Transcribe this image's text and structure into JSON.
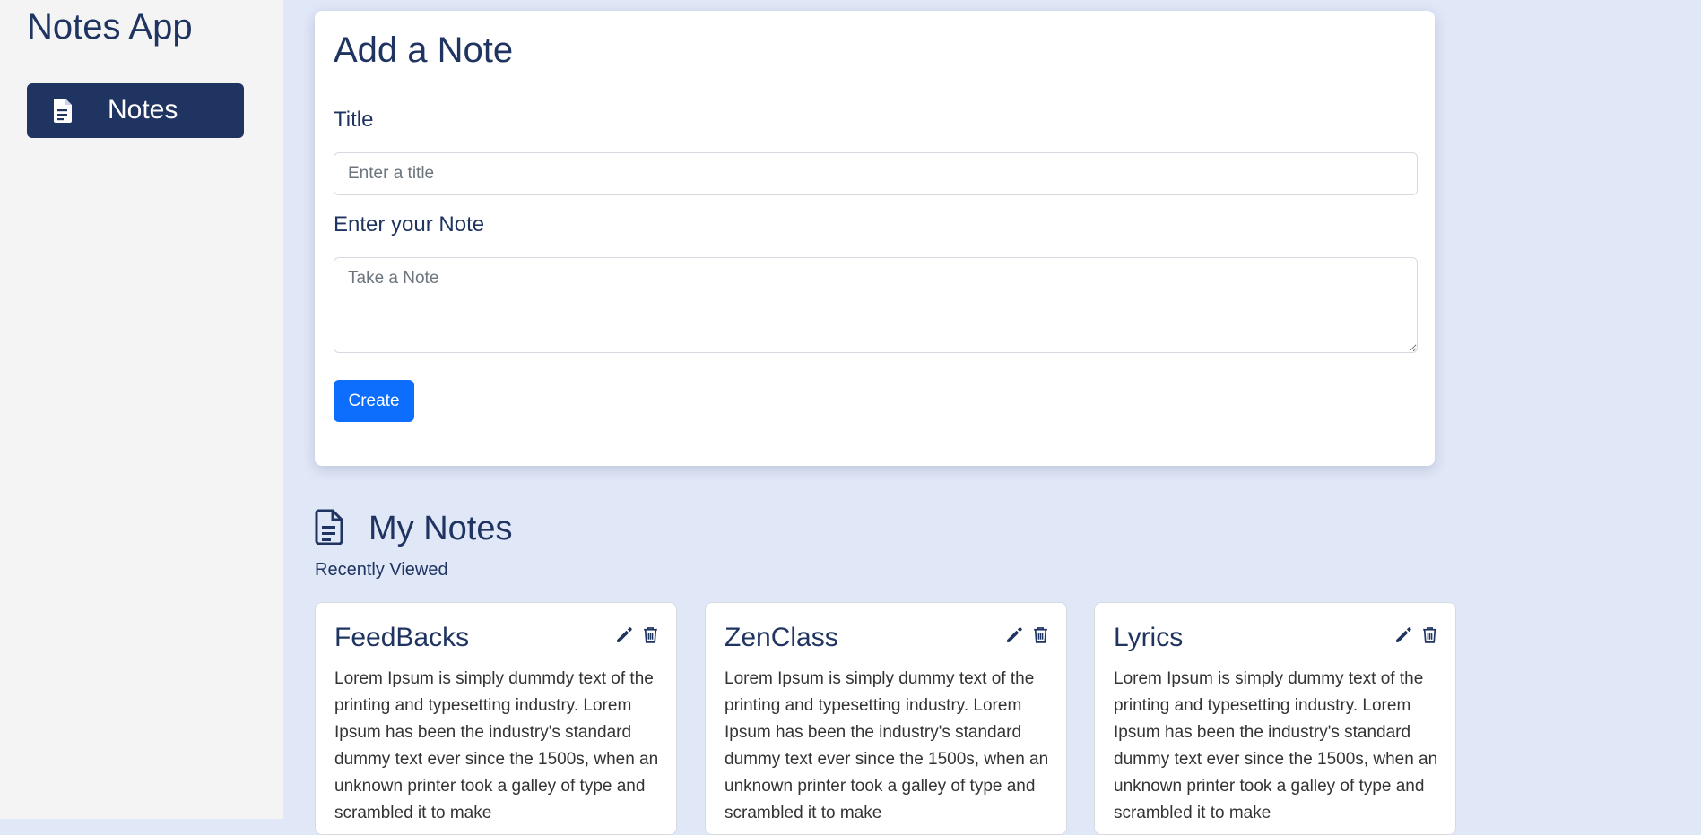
{
  "sidebar": {
    "app_title": "Notes App",
    "nav_items": [
      {
        "label": "Notes",
        "icon": "document-icon",
        "active": true
      }
    ]
  },
  "form": {
    "heading": "Add a Note",
    "title_label": "Title",
    "title_placeholder": "Enter a title",
    "title_value": "",
    "note_label": "Enter your Note",
    "note_placeholder": "Take a Note",
    "note_value": "",
    "create_label": "Create"
  },
  "notes_section": {
    "title": "My Notes",
    "subtitle": "Recently Viewed",
    "icon": "document-icon",
    "notes": [
      {
        "title": "FeedBacks",
        "body": "Lorem Ipsum is simply dummdy text of the printing and typesetting industry. Lorem Ipsum has been the industry's standard dummy text ever since the 1500s, when an unknown printer took a galley of type and scrambled it to make"
      },
      {
        "title": "ZenClass",
        "body": "Lorem Ipsum is simply dummy text of the printing and typesetting industry. Lorem Ipsum has been the industry's standard dummy text ever since the 1500s, when an unknown printer took a galley of type and scrambled it to make"
      },
      {
        "title": "Lyrics",
        "body": "Lorem Ipsum is simply dummy text of the printing and typesetting industry. Lorem Ipsum has been the industry's standard dummy text ever since the 1500s, when an unknown printer took a galley of type and scrambled it to make"
      }
    ]
  },
  "colors": {
    "sidebar_bg": "#f4f4f5",
    "main_bg": "#e0e7f7",
    "primary_dark": "#1f3461",
    "button_blue": "#0d6efd"
  }
}
